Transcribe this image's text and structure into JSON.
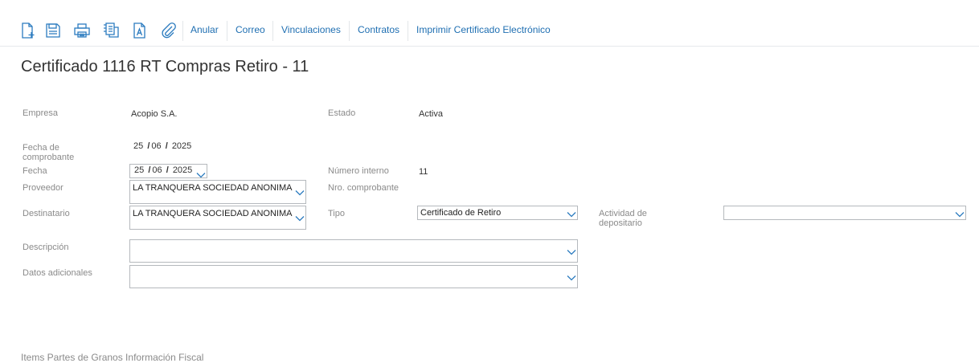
{
  "toolbar": {
    "icons": [
      {
        "name": "new-document-icon"
      },
      {
        "name": "save-icon"
      },
      {
        "name": "print-icon"
      },
      {
        "name": "report-icon"
      },
      {
        "name": "text-document-icon"
      },
      {
        "name": "attachment-icon"
      }
    ],
    "actions": {
      "anular": "Anular",
      "correo": "Correo",
      "vinculaciones": "Vinculaciones",
      "contratos": "Contratos",
      "imprimir": "Imprimir Certificado Electrónico"
    }
  },
  "page": {
    "title": "Certificado 1116 RT Compras Retiro - 11"
  },
  "form": {
    "empresa": {
      "label": "Empresa",
      "value": "Acopio S.A."
    },
    "estado": {
      "label": "Estado",
      "value": "Activa"
    },
    "fecha_comprobante": {
      "label": "Fecha de comprobante",
      "day": "25",
      "month": "06",
      "year": "2025",
      "sep": "/"
    },
    "fecha": {
      "label": "Fecha",
      "day": "25",
      "month": "06",
      "year": "2025",
      "sep": "/"
    },
    "numero_interno": {
      "label": "Número interno",
      "value": "11"
    },
    "proveedor": {
      "label": "Proveedor",
      "value": "LA TRANQUERA SOCIEDAD ANONIMA"
    },
    "nro_comprobante": {
      "label": "Nro. comprobante",
      "value": ""
    },
    "destinatario": {
      "label": "Destinatario",
      "value": "LA TRANQUERA SOCIEDAD ANONIMA"
    },
    "tipo": {
      "label": "Tipo",
      "value": "Certificado de Retiro"
    },
    "actividad_depositario": {
      "label": "Actividad de depositario",
      "value": ""
    },
    "descripcion": {
      "label": "Descripción",
      "value": ""
    },
    "datos_adicionales": {
      "label": "Datos adicionales",
      "value": ""
    }
  },
  "tabs": {
    "text": "Items    Partes de Granos    Información Fiscal"
  },
  "colors": {
    "link": "#1f6fb2",
    "label": "#8a8a8a",
    "border": "#b5b9bd"
  }
}
